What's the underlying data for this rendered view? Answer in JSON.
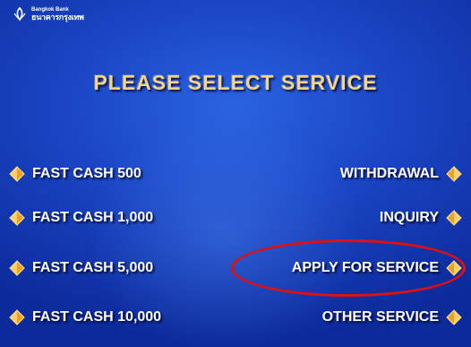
{
  "bank": {
    "name_en": "Bangkok Bank",
    "name_th": "ธนาคารกรุงเทพ"
  },
  "screen_title": "PLEASE SELECT SERVICE",
  "left_options": [
    {
      "label": "FAST CASH 500"
    },
    {
      "label": "FAST CASH 1,000"
    },
    {
      "label": "FAST CASH 5,000"
    },
    {
      "label": "FAST CASH 10,000"
    }
  ],
  "right_options": [
    {
      "label": "WITHDRAWAL"
    },
    {
      "label": "INQUIRY"
    },
    {
      "label": "APPLY FOR SERVICE"
    },
    {
      "label": "OTHER SERVICE"
    }
  ],
  "colors": {
    "background": "#1a45c4",
    "title": "#f2d48a",
    "arrow": "#f0a020",
    "highlight": "#e01010"
  }
}
